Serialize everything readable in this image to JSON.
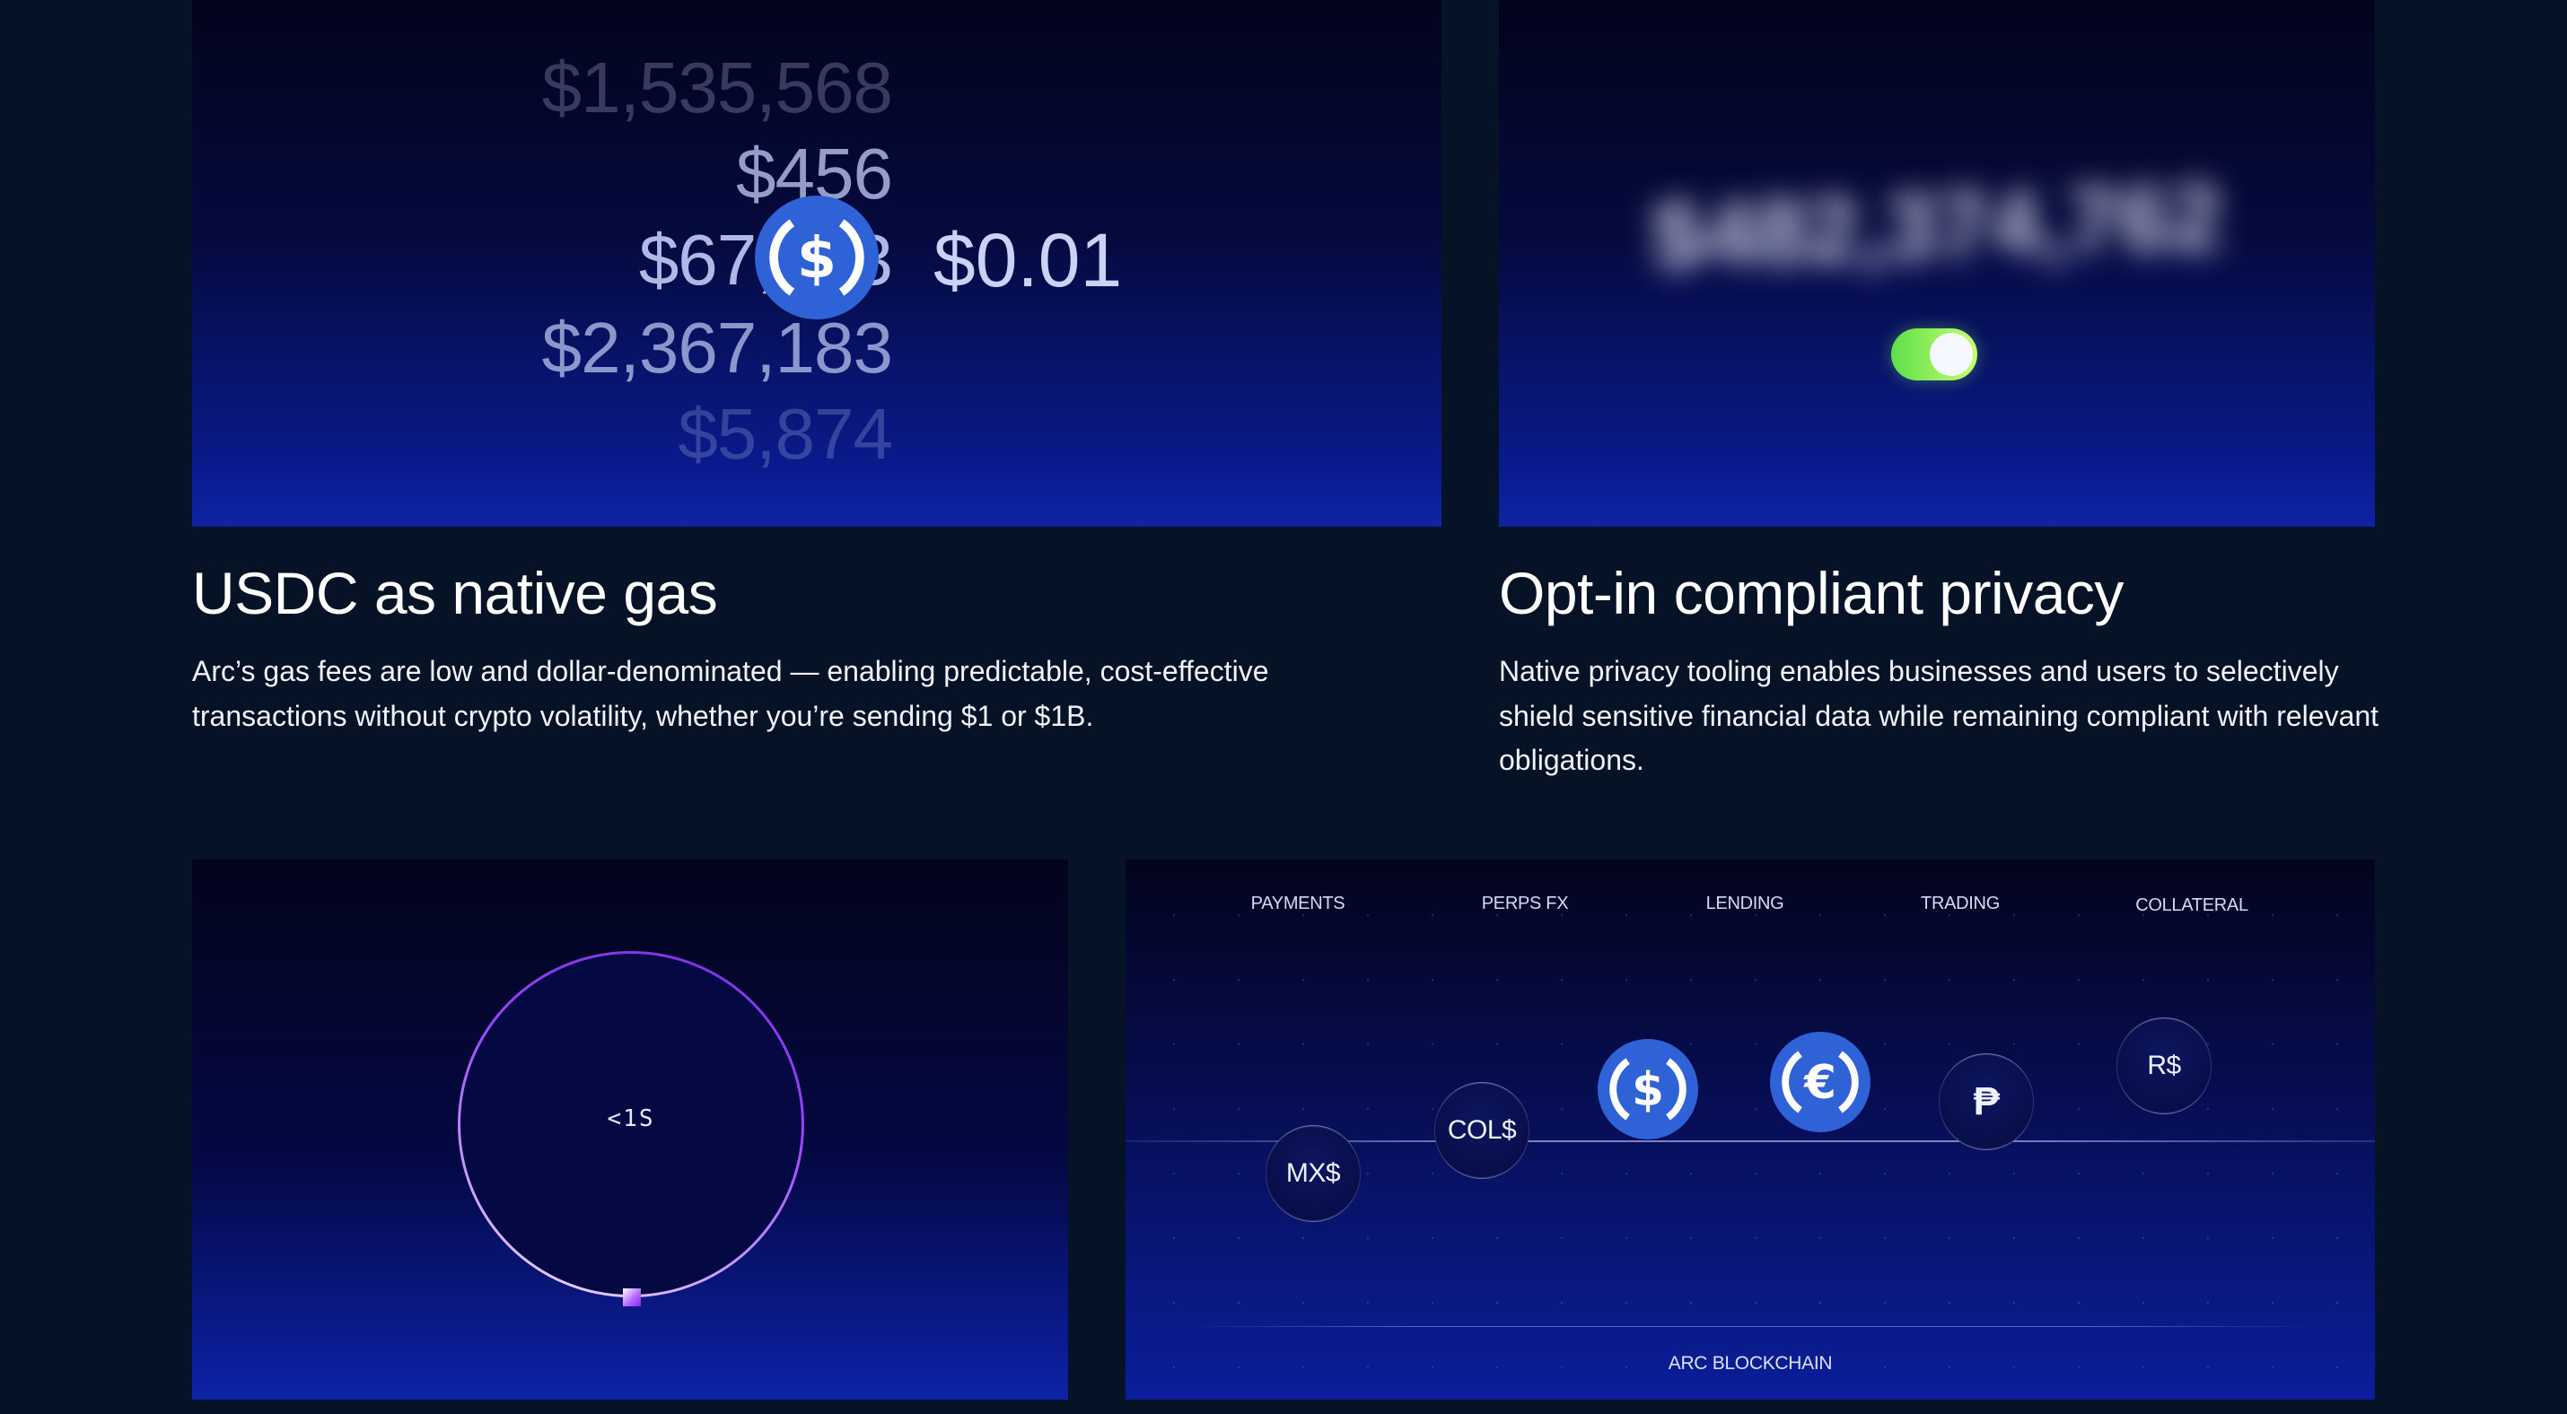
{
  "gas_card": {
    "amounts": [
      "$1,535,568",
      "$456",
      "$67,453",
      "$2,367,183",
      "$5,874"
    ],
    "price": "$0.01",
    "coin_icon": "usdc-dollar-icon",
    "coin_color": "#2f62d6"
  },
  "privacy_card": {
    "blurred_text": "$482,374,762",
    "toggle_state": "on",
    "toggle_color": "#7cf05a"
  },
  "features": [
    {
      "title": "USDC as native gas",
      "description": "Arc’s gas fees are low and dollar-denominated — enabling predictable, cost-effective transactions without crypto volatility, whether you’re sending $1 or $1B."
    },
    {
      "title": "Opt-in compliant privacy",
      "description": "Native privacy tooling enables businesses and users to selectively shield sensitive financial data while remaining compliant with relevant obligations."
    }
  ],
  "finality_card": {
    "label": "<1S",
    "ring_color": "#9945ff"
  },
  "usecases_card": {
    "labels": [
      "PAYMENTS",
      "PERPS FX",
      "LENDING",
      "TRADING",
      "COLLATERAL"
    ],
    "currencies": [
      "MX$",
      "COL$",
      "₱",
      "R$"
    ],
    "coin_icons": [
      "usdc-dollar-icon",
      "eurc-euro-icon"
    ],
    "chain_label": "ARC BLOCKCHAIN"
  }
}
